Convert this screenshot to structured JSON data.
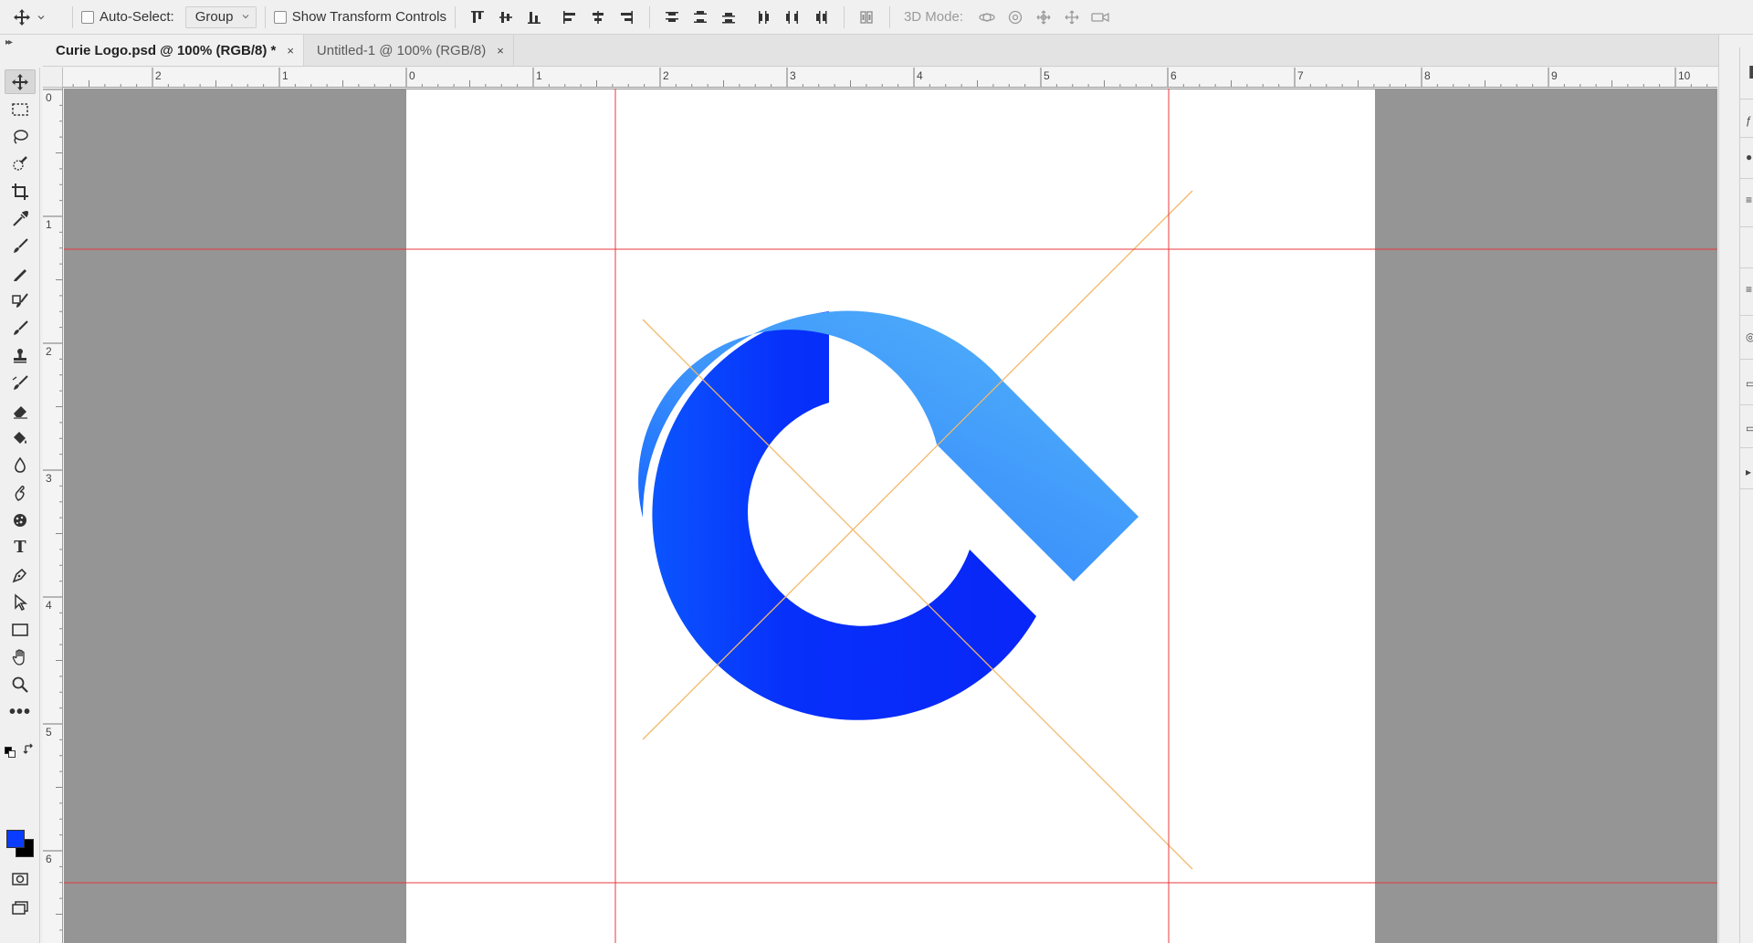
{
  "options_bar": {
    "auto_select_label": "Auto-Select:",
    "auto_select_checked": false,
    "auto_select_target": "Group",
    "show_transform_label": "Show Transform Controls",
    "show_transform_checked": false,
    "mode_3d_label": "3D Mode:"
  },
  "tabs": [
    {
      "label": "Curie Logo.psd @ 100% (RGB/8) *",
      "close": "×",
      "active": true
    },
    {
      "label": "Untitled-1 @ 100% (RGB/8)",
      "close": "×",
      "active": false
    }
  ],
  "toolbar": {
    "active_tool": "move-tool",
    "type_tool_glyph": "T",
    "more_tools_glyph": "•••",
    "foreground_color": "#0a3cff",
    "background_color": "#000000"
  },
  "rulers": {
    "horizontal_labels": [
      "2",
      "1",
      "0",
      "1",
      "2",
      "3",
      "4",
      "5",
      "6",
      "7",
      "8",
      "9",
      "10"
    ],
    "vertical_labels": [
      "0",
      "1",
      "2",
      "3",
      "4",
      "5",
      "6"
    ]
  },
  "colors": {
    "pasteboard": "#959595",
    "guide": "#e8383d",
    "construction_line": "#f3b86a",
    "logo_light_blue": "#50b4fa",
    "logo_dark_blue": "#0826f8"
  }
}
